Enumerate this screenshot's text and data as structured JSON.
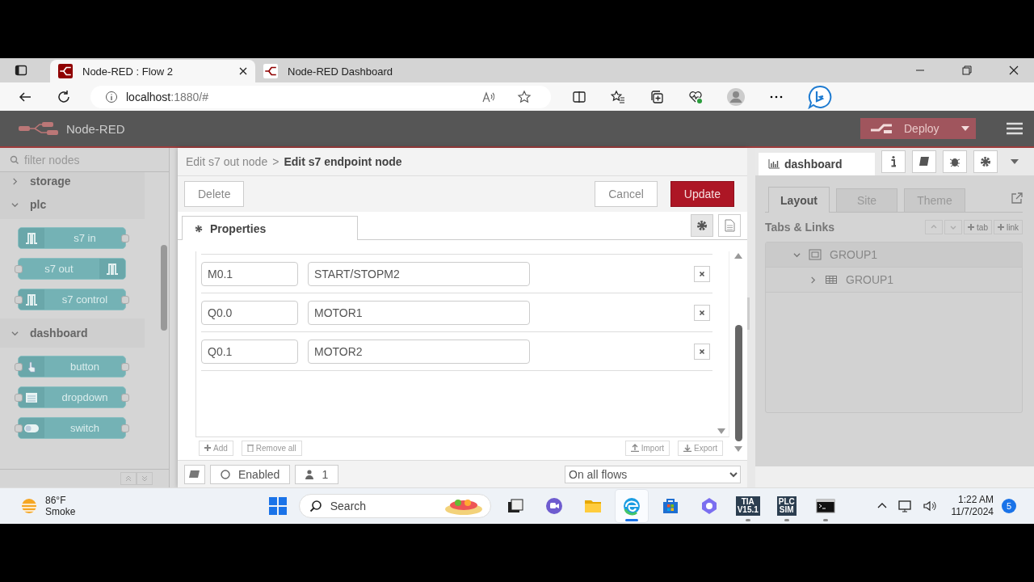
{
  "browser": {
    "tabs": [
      {
        "title": "Node-RED : Flow 2",
        "selected": true
      },
      {
        "title": "Node-RED Dashboard",
        "selected": false
      }
    ],
    "address_host": "localhost",
    "address_rest": ":1880/#"
  },
  "header": {
    "title": "Node-RED",
    "deploy": "Deploy"
  },
  "palette": {
    "filter_placeholder": "filter nodes",
    "categories": [
      {
        "name": "storage",
        "expanded": false
      },
      {
        "name": "plc",
        "expanded": true,
        "nodes": [
          {
            "label": "s7 in",
            "kind": "pulse",
            "input": false,
            "output": true,
            "icon_right": false
          },
          {
            "label": "s7 out",
            "kind": "pulse",
            "input": true,
            "output": false,
            "icon_right": true
          },
          {
            "label": "s7 control",
            "kind": "pulse",
            "input": true,
            "output": true,
            "icon_right": false
          }
        ]
      },
      {
        "name": "dashboard",
        "expanded": true,
        "nodes": [
          {
            "label": "button",
            "kind": "hand",
            "input": true,
            "output": true,
            "icon_right": false
          },
          {
            "label": "dropdown",
            "kind": "list",
            "input": true,
            "output": true,
            "icon_right": false
          },
          {
            "label": "switch",
            "kind": "toggle",
            "input": true,
            "output": true,
            "icon_right": false
          }
        ]
      }
    ]
  },
  "editor": {
    "breadcrumb_parent": "Edit s7 out node",
    "breadcrumb_sep": ">",
    "breadcrumb_current": "Edit s7 endpoint node",
    "delete": "Delete",
    "cancel": "Cancel",
    "update": "Update",
    "tab": "Properties",
    "variables": [
      {
        "address": "M0.1",
        "name": "START/STOPM2"
      },
      {
        "address": "Q0.0",
        "name": "MOTOR1"
      },
      {
        "address": "Q0.1",
        "name": "MOTOR2"
      }
    ],
    "add": "Add",
    "remove_all": "Remove all",
    "import": "Import",
    "export": "Export",
    "enabled": "Enabled",
    "users": "1",
    "scope": "On all flows"
  },
  "sidebar": {
    "tab": "dashboard",
    "subtabs": [
      {
        "label": "Layout",
        "selected": true
      },
      {
        "label": "Site",
        "selected": false
      },
      {
        "label": "Theme",
        "selected": false
      }
    ],
    "section": "Tabs & Links",
    "tab_button": "tab",
    "link_button": "link",
    "tree": [
      {
        "label": "GROUP1",
        "kind": "tab",
        "expanded": true,
        "children": [
          {
            "label": "GROUP1",
            "kind": "group",
            "expanded": false
          }
        ]
      }
    ]
  },
  "taskbar": {
    "temp": "86°F",
    "condition": "Smoke",
    "search_placeholder": "Search",
    "apps": [
      {
        "kind": "taskview",
        "active": false,
        "running": false
      },
      {
        "kind": "chat",
        "active": false,
        "running": false
      },
      {
        "kind": "folder",
        "active": false,
        "running": false
      },
      {
        "kind": "edge",
        "active": true,
        "running": true
      },
      {
        "kind": "store",
        "active": false,
        "running": false
      },
      {
        "kind": "copilot",
        "active": false,
        "running": false
      },
      {
        "kind": "text",
        "line1": "TIA",
        "line2": "V15.1",
        "active": false,
        "running": true
      },
      {
        "kind": "text",
        "line1": "PLC",
        "line2": "SIM",
        "active": false,
        "running": true
      },
      {
        "kind": "terminal",
        "active": false,
        "running": true
      }
    ],
    "time": "1:22 AM",
    "date": "11/7/2024",
    "notifications": "5"
  }
}
